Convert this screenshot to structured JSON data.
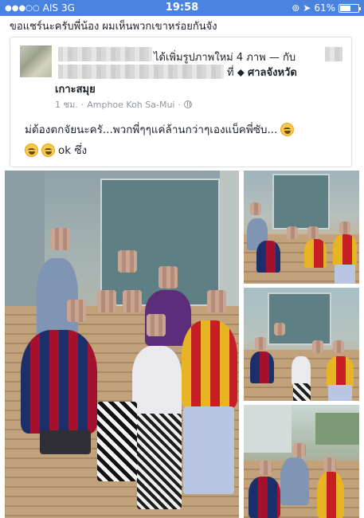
{
  "status_bar": {
    "carrier": "AIS",
    "network": "3G",
    "time": "19:58",
    "battery": "61%",
    "battery_level": 0.61
  },
  "caption": "ขอแชร์นะครับพี่น้อง ผมเห็นพวกเขาหร่อยกันจัง",
  "shared_post": {
    "header_suffix": "ได้เพิ่มรูปภาพใหม่ 4 ภาพ — กับ",
    "location_prefix": "ที่",
    "location_name": "ศาลจังหวัด",
    "location_name_line2": "เกาะสมุย",
    "time_ago": "1 ชม.",
    "place": "Amphoe Koh Sa-Mui",
    "text_line1": "ม่ต้องตกจัยนะครั...พวกพี่ๆๆแค่ล้านกว่าๆเองแบ็คพี่ซับ...",
    "text_line2": "ok ซึ่ง"
  },
  "icons": {
    "signal": "signal-dots-icon",
    "location": "location-arrow-icon",
    "battery": "battery-icon",
    "globe": "globe-icon",
    "map_pin": "map-pin-icon",
    "emoji": "laughing-emoji-icon"
  },
  "colors": {
    "status_bar": "#4a83df",
    "text": "#1d2129",
    "meta": "#90949c",
    "card_border": "#dddfe2"
  }
}
